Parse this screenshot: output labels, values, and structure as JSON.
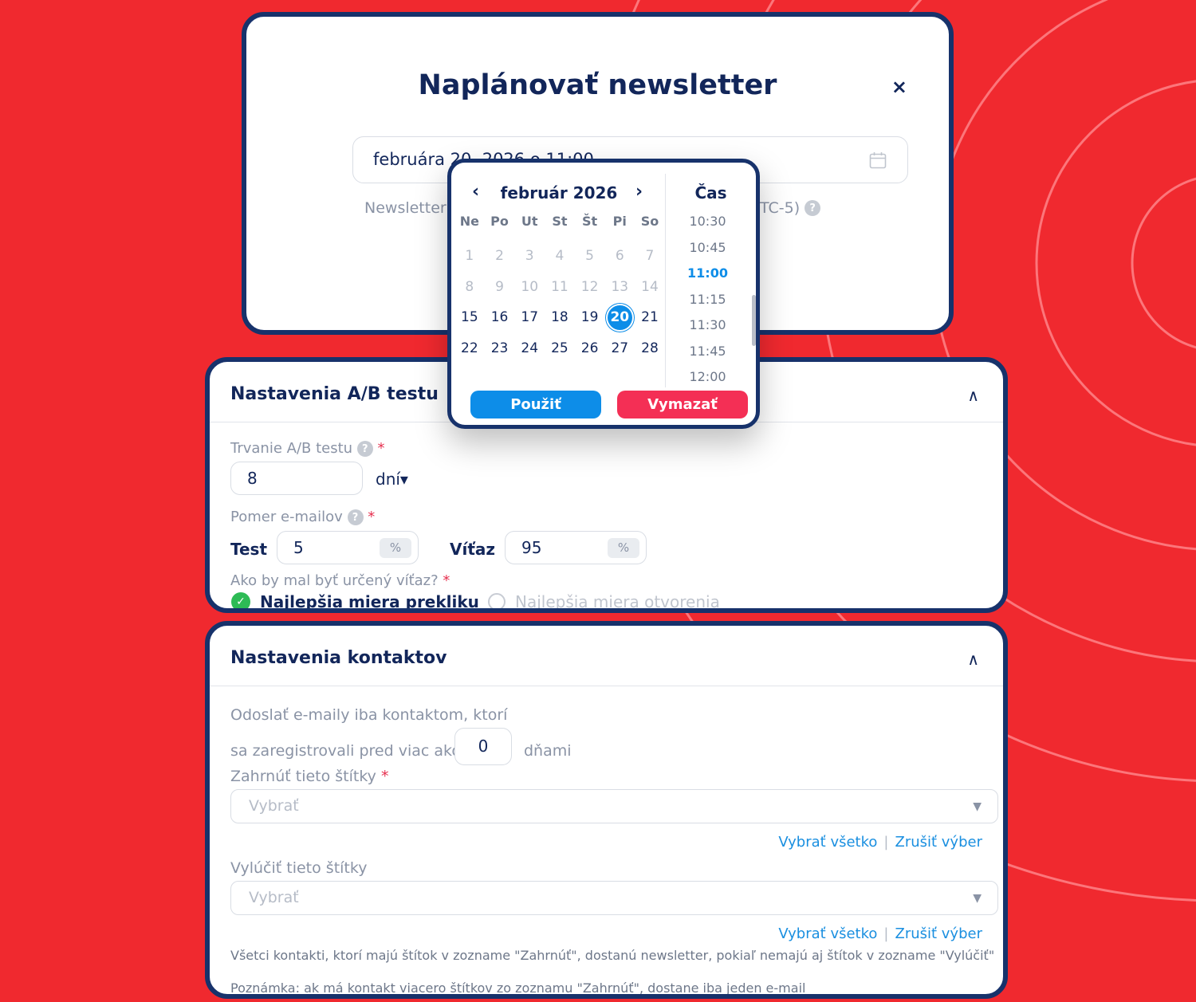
{
  "modal": {
    "title": "Naplánovať newsletter",
    "close_icon": "×",
    "date_value": "februára 20, 2026 o 11:00",
    "timezone_left": "Newsletter",
    "timezone_right": "TC-5)",
    "help_icon": "?"
  },
  "picker": {
    "prev_icon": "‹",
    "next_icon": "›",
    "month_label": "február 2026",
    "weekdays": [
      "Ne",
      "Po",
      "Ut",
      "St",
      "Št",
      "Pi",
      "So"
    ],
    "days": [
      {
        "d": "1",
        "disabled": true
      },
      {
        "d": "2",
        "disabled": true
      },
      {
        "d": "3",
        "disabled": true
      },
      {
        "d": "4",
        "disabled": true
      },
      {
        "d": "5",
        "disabled": true
      },
      {
        "d": "6",
        "disabled": true
      },
      {
        "d": "7",
        "disabled": true
      },
      {
        "d": "8",
        "disabled": true
      },
      {
        "d": "9",
        "disabled": true
      },
      {
        "d": "10",
        "disabled": true
      },
      {
        "d": "11",
        "disabled": true
      },
      {
        "d": "12",
        "disabled": true
      },
      {
        "d": "13",
        "disabled": true
      },
      {
        "d": "14",
        "disabled": true
      },
      {
        "d": "15"
      },
      {
        "d": "16"
      },
      {
        "d": "17"
      },
      {
        "d": "18"
      },
      {
        "d": "19"
      },
      {
        "d": "20",
        "selected": true
      },
      {
        "d": "21"
      },
      {
        "d": "22"
      },
      {
        "d": "23"
      },
      {
        "d": "24"
      },
      {
        "d": "25"
      },
      {
        "d": "26"
      },
      {
        "d": "27"
      },
      {
        "d": "28"
      }
    ],
    "time_header": "Čas",
    "times": [
      "10:30",
      "10:45",
      "11:00",
      "11:15",
      "11:30",
      "11:45",
      "12:00"
    ],
    "active_time": "11:00",
    "apply_label": "Použiť",
    "clear_label": "Vymazať"
  },
  "ab_settings": {
    "title": "Nastavenia A/B testu",
    "collapse_icon": "∧",
    "duration_label": "Trvanie A/B testu",
    "duration_value": "8",
    "duration_unit": "dní▾",
    "ratio_label": "Pomer e-mailov",
    "test_label": "Test",
    "test_value": "5",
    "winner_label": "Víťaz",
    "winner_value": "95",
    "percent_suffix": "%",
    "winner_question": "Ako by mal byť určený víťaz?",
    "required_mark": "*",
    "option_click": "Najlepšia miera prekliku",
    "option_open": "Najlepšia miera otvorenia",
    "check_icon": "✓"
  },
  "contacts_settings": {
    "title": "Nastavenia kontaktov",
    "collapse_icon": "∧",
    "send_only_line1": "Odoslať e-maily iba kontaktom, ktorí",
    "send_only_line2": "sa zaregistrovali pred viac ako",
    "days_value": "0",
    "days_suffix": "dňami",
    "include_label": "Zahrnúť tieto štítky",
    "include_placeholder": "Vybrať",
    "exclude_label": "Vylúčiť tieto štítky",
    "exclude_placeholder": "Vybrať",
    "select_all": "Vybrať všetko",
    "clear_selection": "Zrušiť výber",
    "separator": "|",
    "dropdown_icon": "▼",
    "note1": "Všetci kontakti, ktorí majú štítok v zozname \"Zahrnúť\", dostanú newsletter, pokiaľ nemajú aj štítok v zozname \"Vylúčiť\"",
    "note2": "Poznámka: ak má kontakt viacero štítkov zo zoznamu \"Zahrnúť\", dostane iba jeden e-mail"
  },
  "colors": {
    "background": "#f0292f",
    "navy": "#12265a",
    "primary_blue": "#0d8de8",
    "danger_pink": "#f42f55",
    "success_green": "#2dbb55"
  }
}
